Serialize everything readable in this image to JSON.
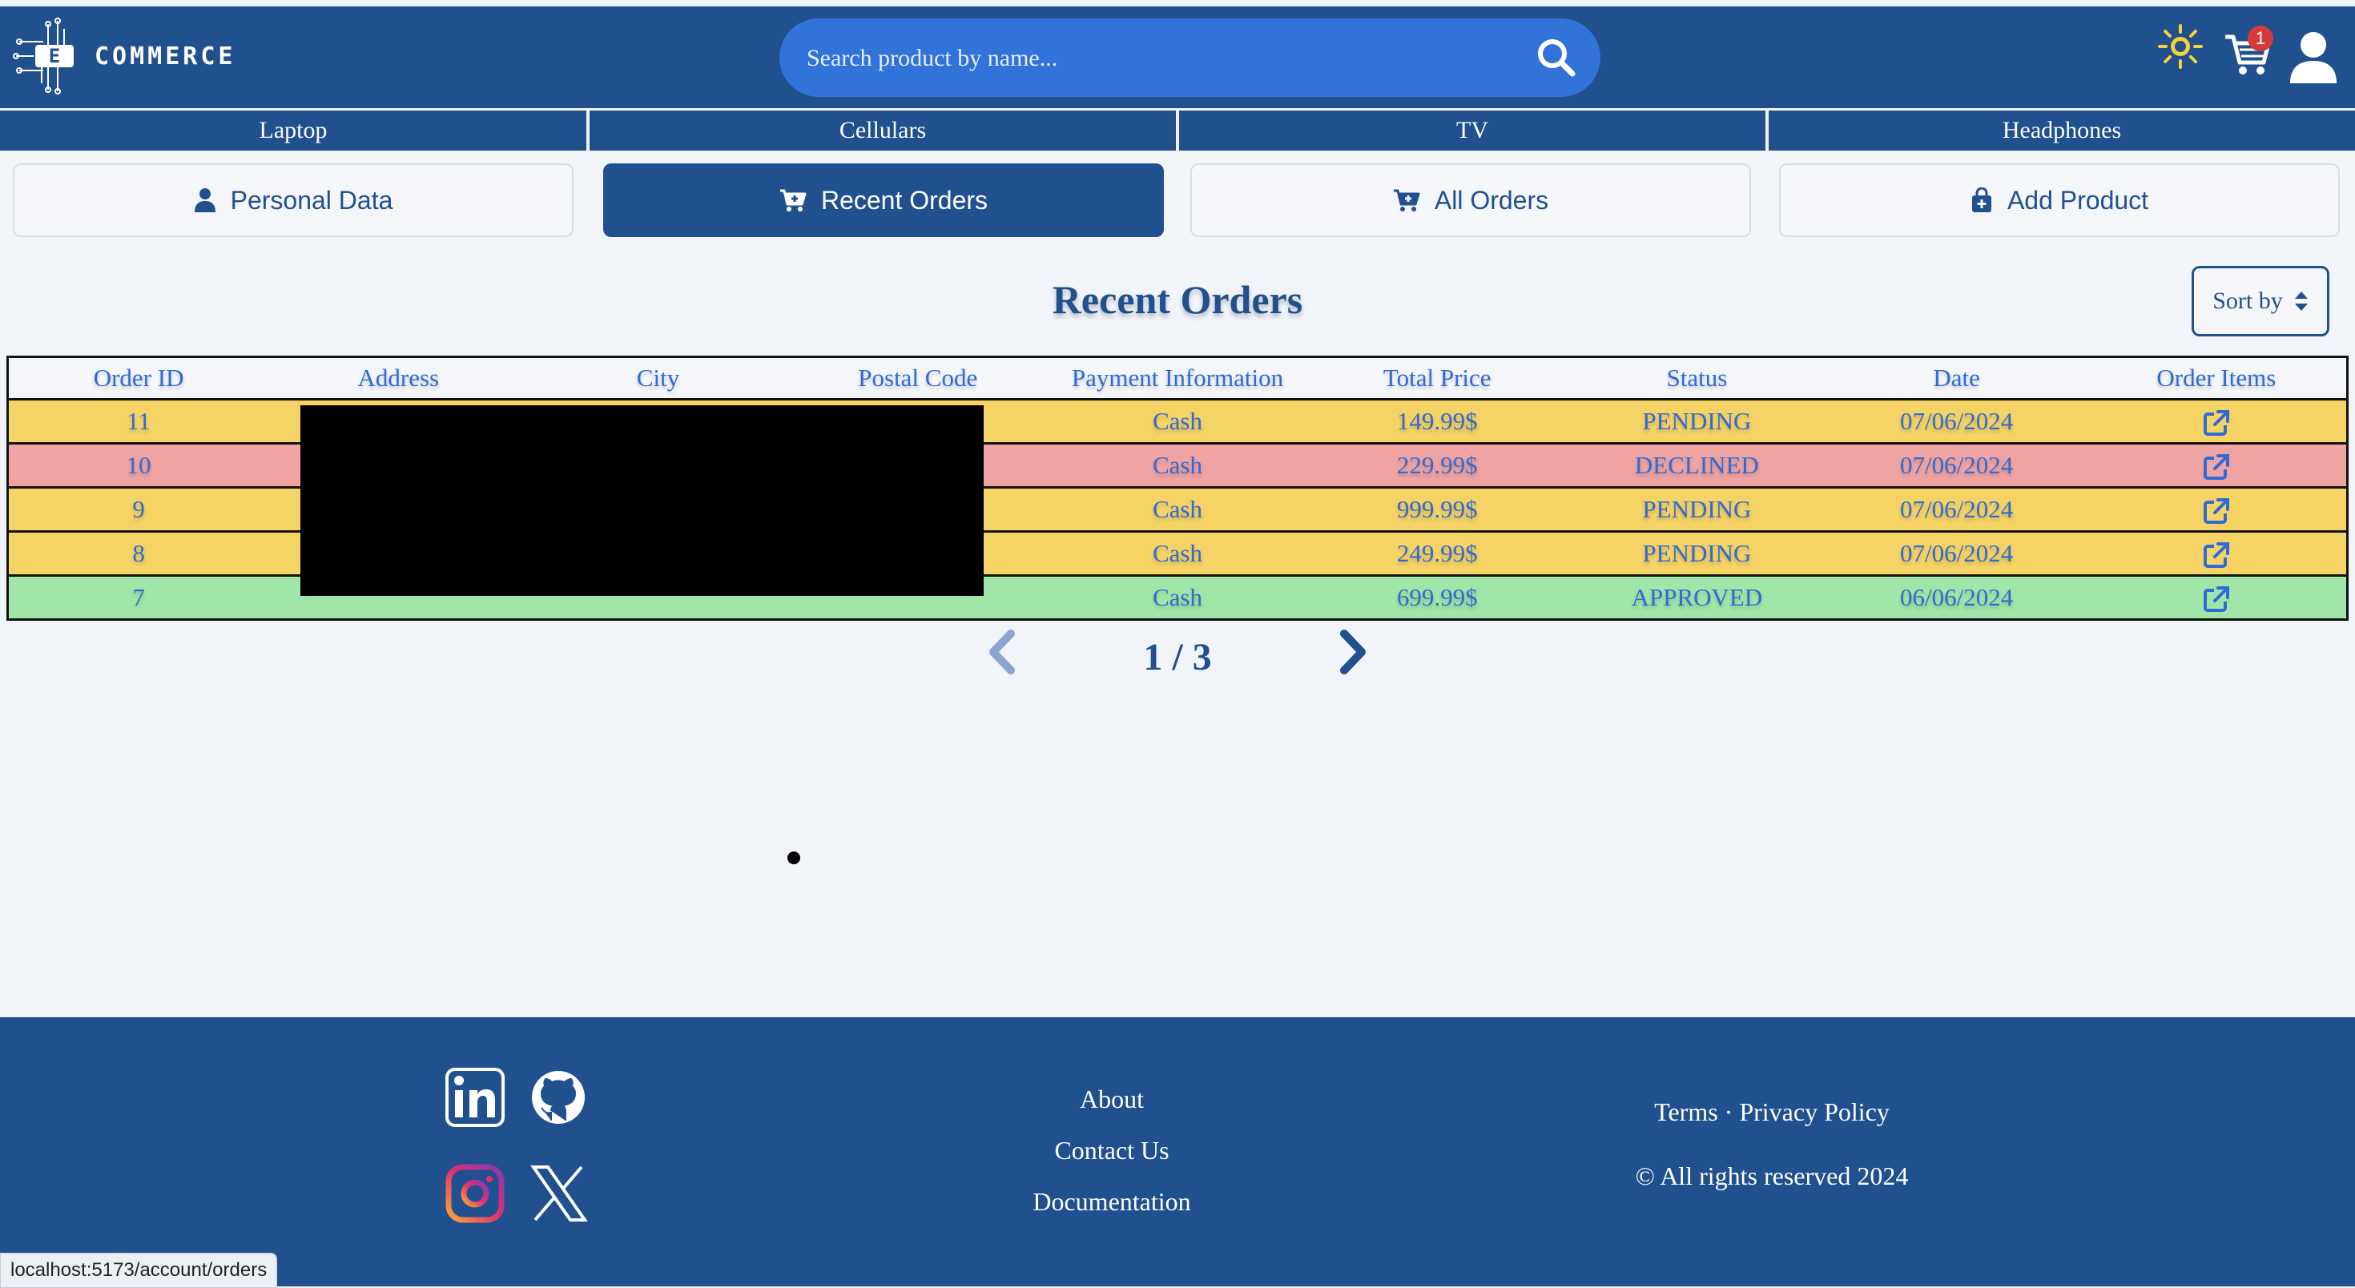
{
  "header": {
    "logo_text": "COMMERCE",
    "logo_mark": "E",
    "search_placeholder": "Search product by name...",
    "cart_count": "1"
  },
  "categories": [
    "Laptop",
    "Cellulars",
    "TV",
    "Headphones"
  ],
  "tabs": [
    {
      "label": "Personal Data",
      "icon": "user-icon"
    },
    {
      "label": "Recent Orders",
      "icon": "cart-icon",
      "active": true
    },
    {
      "label": "All Orders",
      "icon": "cart-icon"
    },
    {
      "label": "Add Product",
      "icon": "bag-icon"
    }
  ],
  "page": {
    "heading": "Recent Orders",
    "sort_label": "Sort by"
  },
  "table": {
    "columns": [
      "Order ID",
      "Address",
      "City",
      "Postal Code",
      "Payment Information",
      "Total Price",
      "Status",
      "Date",
      "Order Items"
    ],
    "rows": [
      {
        "id": "11",
        "payment": "Cash",
        "total": "149.99$",
        "status": "PENDING",
        "date": "07/06/2024"
      },
      {
        "id": "10",
        "payment": "Cash",
        "total": "229.99$",
        "status": "DECLINED",
        "date": "07/06/2024"
      },
      {
        "id": "9",
        "payment": "Cash",
        "total": "999.99$",
        "status": "PENDING",
        "date": "07/06/2024"
      },
      {
        "id": "8",
        "payment": "Cash",
        "total": "249.99$",
        "status": "PENDING",
        "date": "07/06/2024"
      },
      {
        "id": "7",
        "payment": "Cash",
        "total": "699.99$",
        "status": "APPROVED",
        "date": "06/06/2024"
      }
    ]
  },
  "status_colors": {
    "PENDING": "#f6d365",
    "DECLINED": "#f0a3a3",
    "APPROVED": "#a1e6a9"
  },
  "pagination": {
    "label": "1 / 3"
  },
  "footer": {
    "links": [
      "About",
      "Contact Us",
      "Documentation"
    ],
    "legal": "Terms · Privacy Policy",
    "copyright": "© All rights reserved 2024",
    "social": [
      "linkedin-icon",
      "github-icon",
      "instagram-icon",
      "x-icon"
    ]
  },
  "status_bar_url": "localhost:5173/account/orders"
}
